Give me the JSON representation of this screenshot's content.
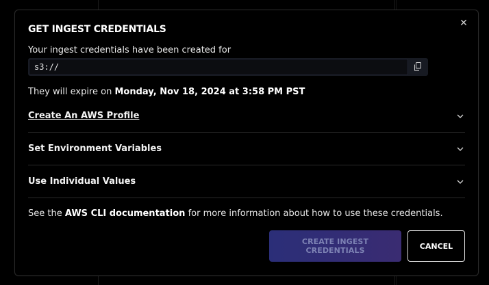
{
  "dialog": {
    "title": "GET INGEST CREDENTIALS",
    "close_icon": "close-icon",
    "intro_text": "Your ingest credentials have been created for",
    "uri_value": "s3://",
    "copy_icon": "copy-icon",
    "expire_prefix": "They will expire on",
    "expire_date": "Monday, Nov 18, 2024 at 3:58 PM PST",
    "sections": [
      {
        "label": "Create An AWS Profile"
      },
      {
        "label": "Set Environment Variables"
      },
      {
        "label": "Use Individual Values"
      }
    ],
    "footer_prefix": "See the",
    "footer_link": "AWS CLI documentation",
    "footer_suffix": "for more information about how to use these credentials.",
    "create_button": "CREATE INGEST CREDENTIALS",
    "cancel_button": "CANCEL"
  },
  "colors": {
    "background": "#000000",
    "border": "#2a2a2a",
    "accent_gradient_start": "#2b2e78",
    "accent_gradient_end": "#3a2c72"
  }
}
